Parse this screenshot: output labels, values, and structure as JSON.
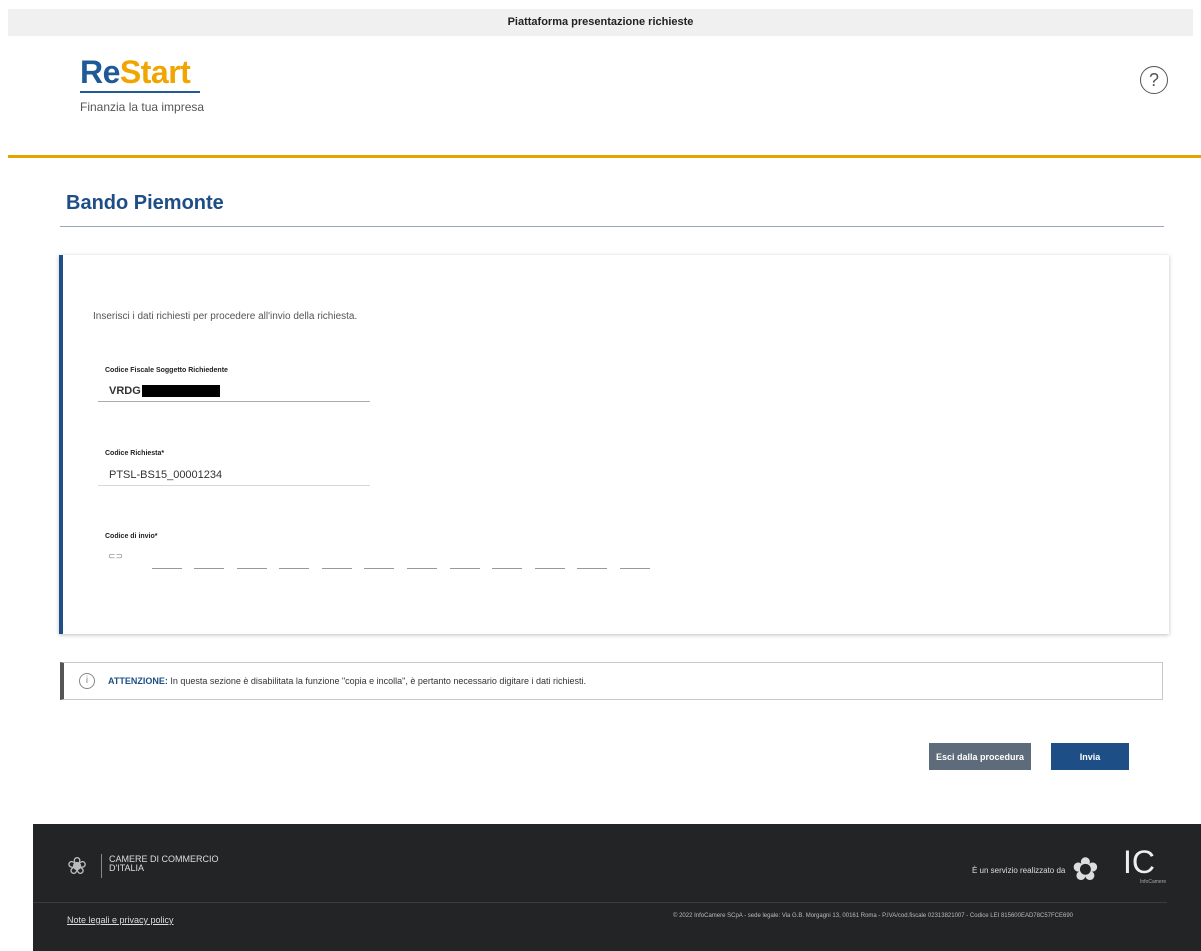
{
  "topbar": {
    "title": "Piattaforma presentazione richieste"
  },
  "header": {
    "logo_re": "Re",
    "logo_start": "Start",
    "logo_tagline": "Finanzia la tua impresa",
    "help_icon": "question-circle-icon",
    "help_symbol": "?"
  },
  "page": {
    "title": "Bando Piemonte"
  },
  "form": {
    "intro": "Inserisci i dati richiesti per procedere all'invio della richiesta.",
    "codice_fiscale": {
      "label": "Codice Fiscale Soggetto Richiedente",
      "value": "VRDG"
    },
    "codice_richiesta": {
      "label": "Codice Richiesta*",
      "value": "PTSL-BS15_00001234"
    },
    "codice_invio": {
      "label": "Codice di invio*",
      "key_icon": "key-icon",
      "key_symbol": "⊂⊃",
      "slot_count": 12
    }
  },
  "notice": {
    "icon": "info-circle-icon",
    "icon_symbol": "i",
    "bold": "ATTENZIONE:",
    "text": " In questa sezione è disabilitata la funzione \"copia e incolla\", è pertanto necessario digitare i dati richiesti."
  },
  "actions": {
    "exit_label": "Esci dalla procedura",
    "send_label": "Invia"
  },
  "footer": {
    "org_icon": "camere-commercio-logo",
    "org_line1": "CAMERE DI COMMERCIO",
    "org_line2": "D'ITALIA",
    "service_text": "È un servizio realizzato da",
    "ic_logo": "IC",
    "ic_sub": "InfoCamere",
    "legal_link": "Note legali e privacy policy",
    "copyright": "© 2022 InfoCamere SCpA - sede legale: Via G.B. Morgagni 13, 00161 Roma - P.IVA/cod.fiscale 02313821007 - Codice LEI 815600EAD78C57FCE690"
  },
  "colors": {
    "brand_blue": "#1d4f86",
    "brand_gold": "#e6a400",
    "footer_bg": "#222426"
  }
}
